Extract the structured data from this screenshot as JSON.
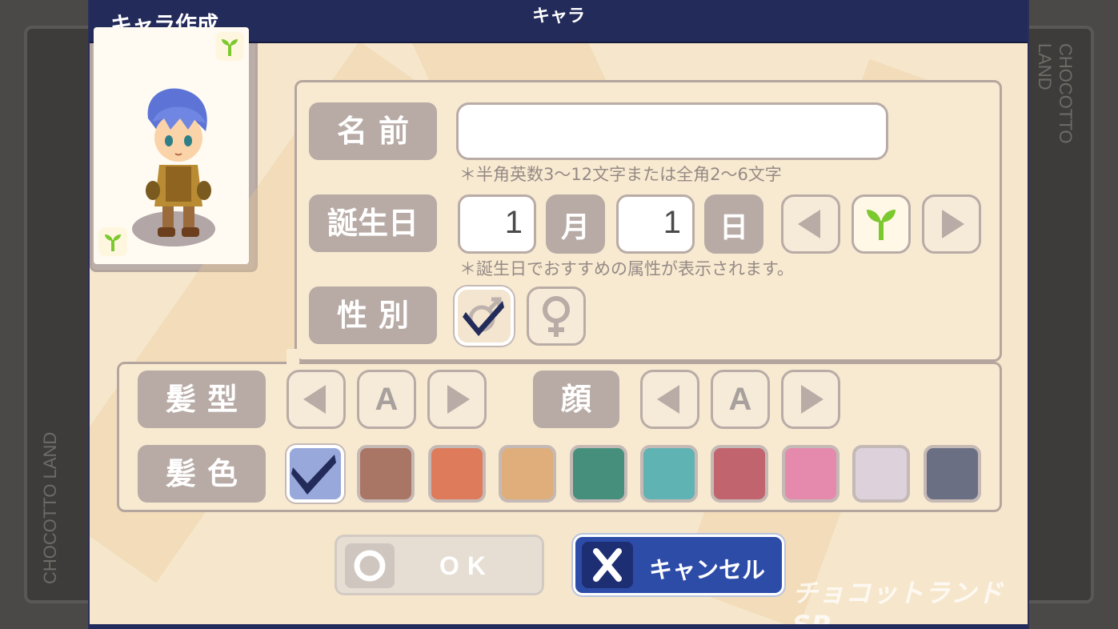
{
  "title": "キャラ作成",
  "side_text": "CHOCOTTO LAND",
  "character": {
    "panel_label": "キャラ"
  },
  "form": {
    "name_label": "名前",
    "name_value": "",
    "name_hint": "＊半角英数3〜12文字または全角2〜6文字",
    "birthday_label": "誕生日",
    "birthday_month": "1",
    "month_unit": "月",
    "birthday_day": "1",
    "day_unit": "日",
    "birthday_hint": "＊誕生日でおすすめの属性が表示されます。",
    "gender_label": "性別",
    "gender_options": [
      "male",
      "female"
    ],
    "gender_selected": "male",
    "hairstyle_label": "髪型",
    "hairstyle_value": "A",
    "face_label": "顔",
    "face_value": "A",
    "hair_color_label": "髪色",
    "hair_colors": [
      "#98a8db",
      "#a97565",
      "#dd7b5a",
      "#dfae7a",
      "#468f7c",
      "#60b3b3",
      "#c1646d",
      "#e58aac",
      "#ddd2dc",
      "#6b6f84"
    ],
    "hair_color_selected_index": 0
  },
  "buttons": {
    "ok": "OK",
    "cancel": "キャンセル"
  },
  "logo": "チョコットランドSP",
  "colors": {
    "title_bar": "#232b5b",
    "panel_bg": "#f8ead0",
    "label_bg": "#b8aba6",
    "cancel_bg": "#2c4ca8",
    "check": "#232b5b",
    "sprout": "#7cc92f"
  }
}
